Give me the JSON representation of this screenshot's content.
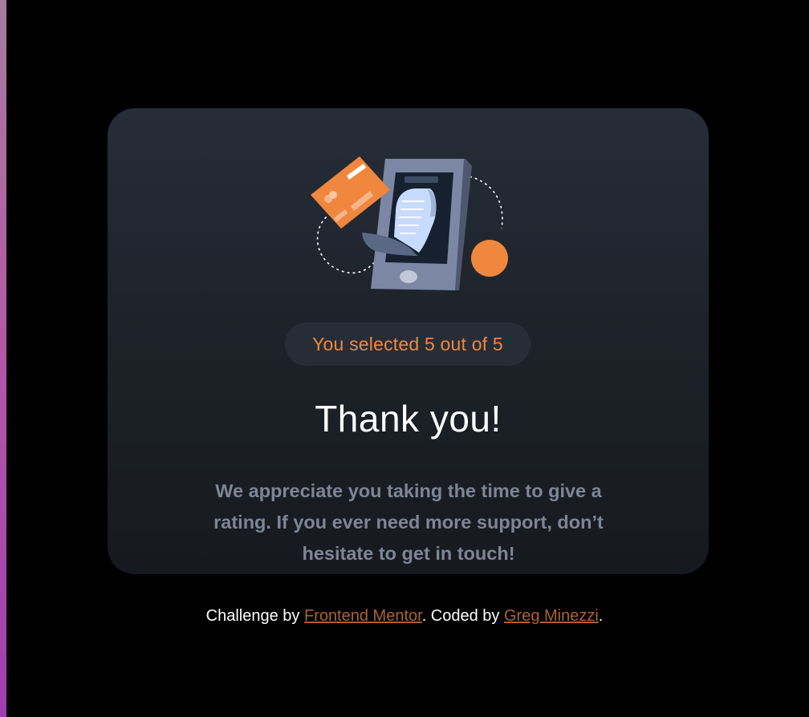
{
  "rating": {
    "selected_text": "You selected 5 out of 5",
    "selected_value": 5,
    "max_value": 5
  },
  "thank_you": {
    "title": "Thank you!",
    "message": "We appreciate you taking the time to give a\nrating. If you ever need more support, don’t\nhesitate to get in touch!"
  },
  "attribution": {
    "prefix": "Challenge by ",
    "challenge_link": "Frontend Mentor",
    "middle": ". Coded by ",
    "author_link": "Greg Minezzi",
    "suffix": "."
  },
  "illustration": {
    "icon": "phone-payment-illustration",
    "colors": {
      "accent": "#f0873f",
      "phone": "#7c87a5",
      "receipt": "#c6dbff"
    }
  },
  "colors": {
    "background": "#000000",
    "card_top": "#262d38",
    "card_bottom": "#16191e",
    "accent": "#f0873f",
    "muted_text": "#7d8596",
    "link": "#b0612f"
  }
}
